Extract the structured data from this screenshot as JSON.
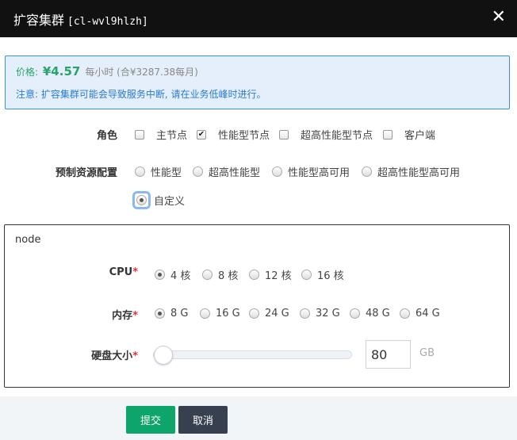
{
  "dialog": {
    "title": "扩容集群",
    "cluster_id": "[cl-wvl9hlzh]",
    "close_icon": "✕"
  },
  "price": {
    "label": "价格:",
    "value": "¥4.57",
    "unit": "每小时 (合¥3287.38每月)"
  },
  "notice": "注意: 扩容集群可能会导致服务中断, 请在业务低峰时进行。",
  "role": {
    "label": "角色",
    "options": [
      {
        "label": "主节点",
        "checked": false
      },
      {
        "label": "性能型节点",
        "checked": true
      },
      {
        "label": "超高性能型节点",
        "checked": false
      },
      {
        "label": "客户端",
        "checked": false
      }
    ]
  },
  "preset": {
    "label": "预制资源配置",
    "options": [
      "性能型",
      "超高性能型",
      "性能型高可用",
      "超高性能型高可用",
      "自定义"
    ],
    "selected": "自定义"
  },
  "node": {
    "title": "node",
    "cpu": {
      "label": "CPU",
      "required": "*",
      "options": [
        "4 核",
        "8 核",
        "12 核",
        "16 核"
      ],
      "selected": "4 核"
    },
    "memory": {
      "label": "内存",
      "required": "*",
      "options": [
        "8 G",
        "16 G",
        "24 G",
        "32 G",
        "48 G",
        "64 G"
      ],
      "selected": "8 G"
    },
    "disk": {
      "label": "硬盘大小",
      "required": "*",
      "value": "80",
      "unit": "GB",
      "slider_fraction": 0.0
    }
  },
  "buttons": {
    "submit": "提交",
    "cancel": "取消"
  },
  "colors": {
    "accent_green": "#0ea56a",
    "cancel_dark": "#36404f",
    "notice_blue": "#2a7bd0"
  }
}
